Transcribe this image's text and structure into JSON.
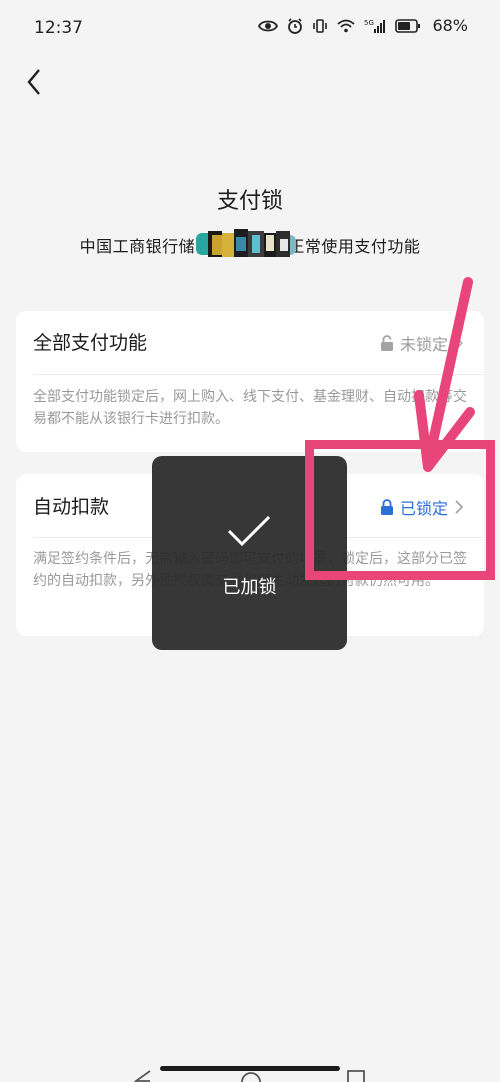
{
  "status_bar": {
    "time": "12:37",
    "network": "5G",
    "battery": "68%"
  },
  "page": {
    "title": "支付锁",
    "subtitle": "中国工商银行储蓄██████正常使用支付功能"
  },
  "cards": [
    {
      "title": "全部支付功能",
      "status": "未锁定",
      "locked": false,
      "description": "全部支付功能锁定后，网上购入、线下支付、基金理财、自动扣款等交易都不能从该银行卡进行扣款。"
    },
    {
      "title": "自动扣款",
      "status": "已锁定",
      "locked": true,
      "description": "满足签约条件后，无需输入密码即可支付的场景，锁定后，这部分已签约的自动扣款，另外预授权类交易和您主动发起的付款仍然可用。"
    }
  ],
  "toast": {
    "label": "已加锁"
  },
  "colors": {
    "accent_blue": "#2d6fd9",
    "annotation_pink": "#e8457a",
    "muted_gray": "#9b9b9b"
  }
}
